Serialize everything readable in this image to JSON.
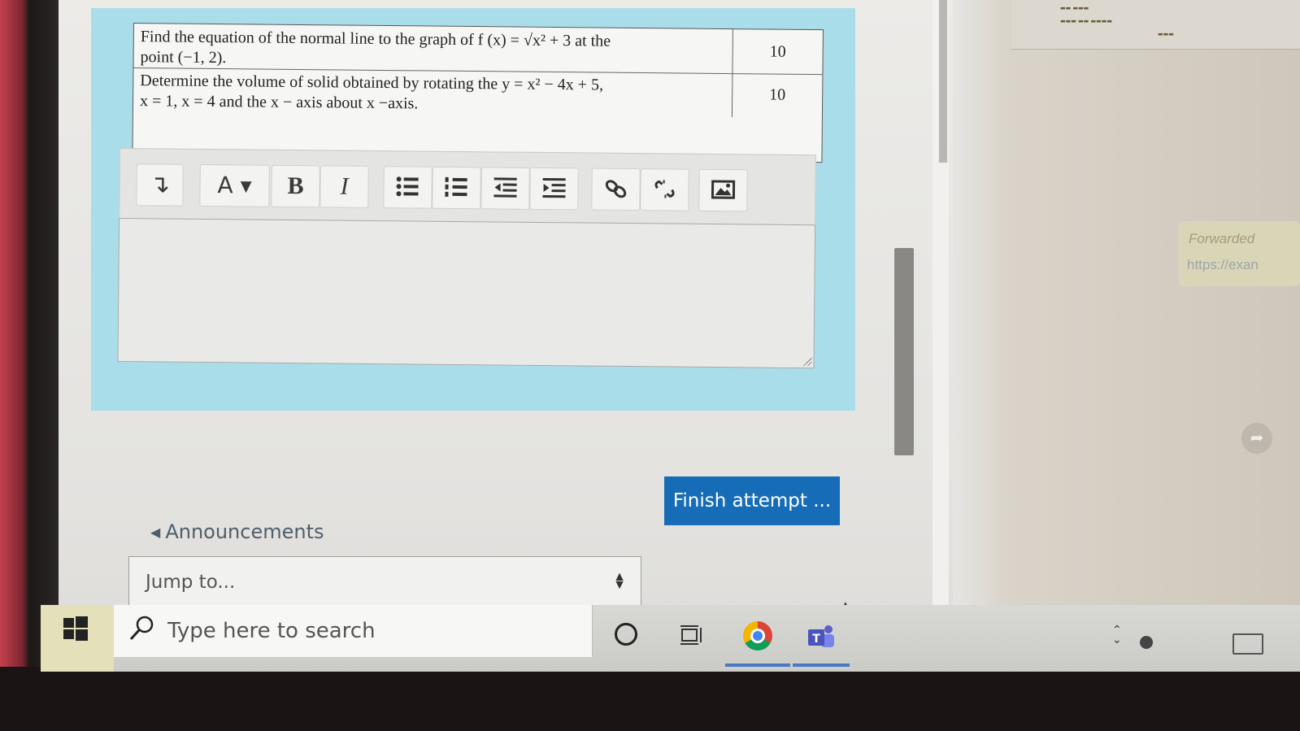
{
  "question": {
    "rows": [
      {
        "line1": "Find the equation of the normal line to the graph of f (x) = √x² + 3  at the",
        "line2": "point (−1, 2).",
        "marks": "10"
      },
      {
        "line1": "Determine the volume of solid obtained by rotating the y = x² − 4x + 5,",
        "line2": "x = 1, x = 4 and the x − axis about x −axis.",
        "marks": "10"
      }
    ]
  },
  "editor": {
    "toolbar": [
      {
        "name": "collapse-toolbar-icon",
        "glyph": "↴"
      },
      {
        "name": "font-color-button",
        "glyph": "A ▾"
      },
      {
        "name": "bold-button",
        "glyph": "B"
      },
      {
        "name": "italic-button",
        "glyph": "I"
      },
      {
        "name": "bullet-list-icon",
        "glyph": ""
      },
      {
        "name": "numbered-list-icon",
        "glyph": ""
      },
      {
        "name": "outdent-icon",
        "glyph": ""
      },
      {
        "name": "indent-icon",
        "glyph": ""
      },
      {
        "name": "link-icon",
        "glyph": ""
      },
      {
        "name": "unlink-icon",
        "glyph": ""
      },
      {
        "name": "image-icon",
        "glyph": ""
      }
    ]
  },
  "actions": {
    "finish_label": "Finish attempt ..."
  },
  "navigation": {
    "announcements_label": "Announcements",
    "jump_placeholder": "Jump to..."
  },
  "side_chat": {
    "forwarded_label": "Forwarded",
    "link_preview": "https://exan"
  },
  "taskbar": {
    "search_placeholder": "Type here to search"
  }
}
